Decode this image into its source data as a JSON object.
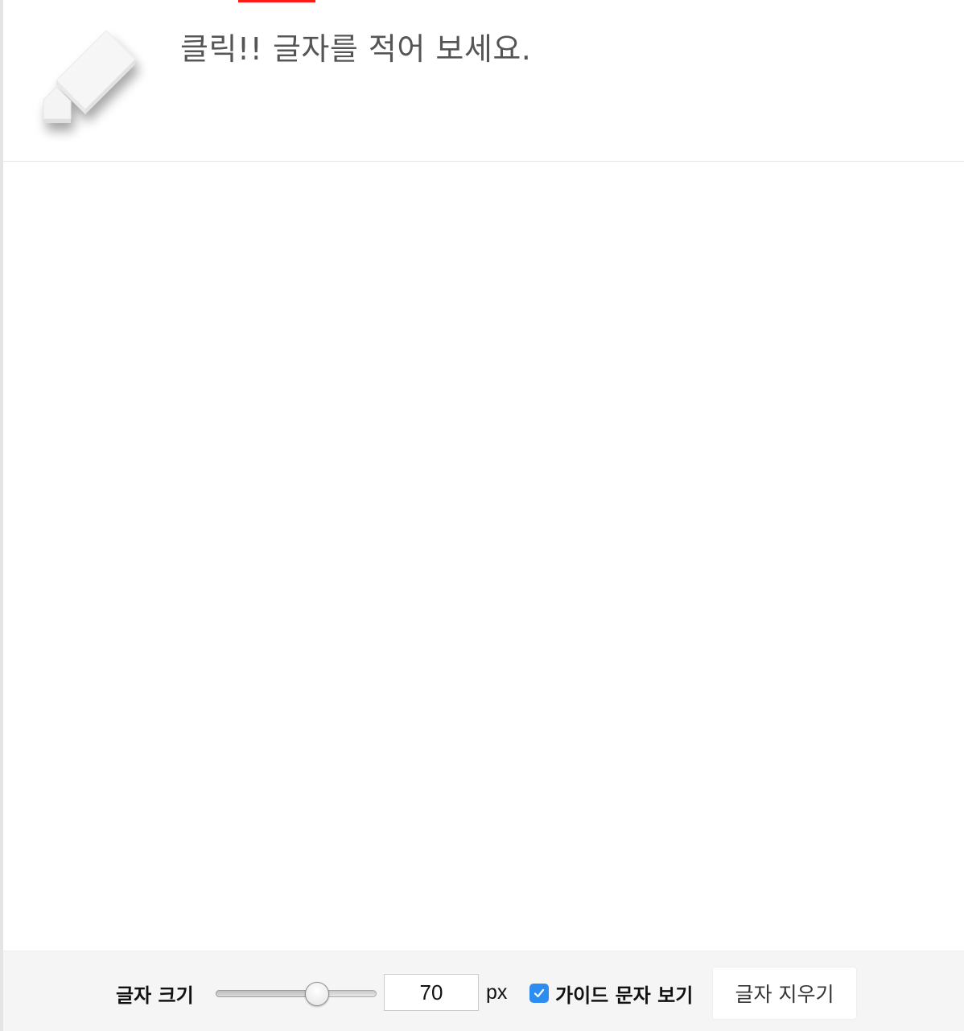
{
  "header": {
    "hint": "클릭!! 글자를 적어 보세요.",
    "icon": "pencil-icon"
  },
  "toolbar": {
    "size_label": "글자 크기",
    "font_size_value": "70",
    "font_size_slider_fraction": 0.65,
    "unit_label": "px",
    "guide_checked": true,
    "guide_label": "가이드 문자 보기",
    "clear_button_label": "글자 지우기"
  },
  "colors": {
    "accent_red": "#ff1a1a",
    "checkbox_blue": "#2d8cf0",
    "toolbar_bg": "#f5f5f5"
  }
}
